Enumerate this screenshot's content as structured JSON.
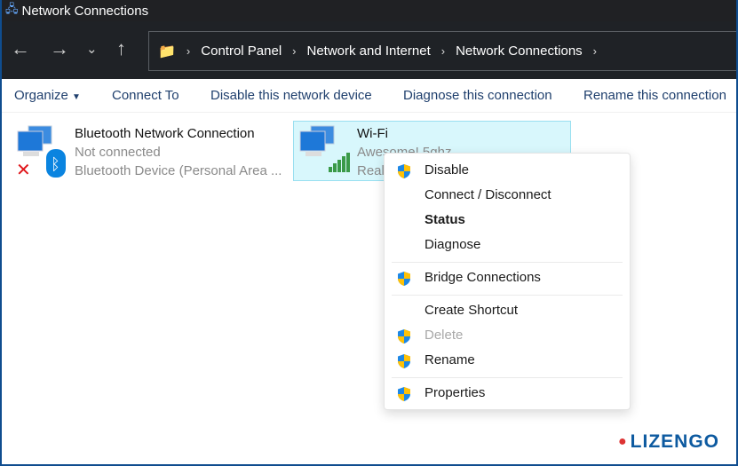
{
  "window": {
    "title": "Network Connections"
  },
  "breadcrumb": [
    "Control Panel",
    "Network and Internet",
    "Network Connections"
  ],
  "toolbar": {
    "organize": "Organize",
    "connect_to": "Connect To",
    "disable": "Disable this network device",
    "diagnose": "Diagnose this connection",
    "rename": "Rename this connection"
  },
  "connections": [
    {
      "name": "Bluetooth Network Connection",
      "status": "Not connected",
      "device": "Bluetooth Device (Personal Area ..."
    },
    {
      "name": "Wi-Fi",
      "status": "Awesome! 5ghz",
      "device": "Real"
    }
  ],
  "context_menu": [
    {
      "label": "Disable",
      "shield": true
    },
    {
      "label": "Connect / Disconnect",
      "shield": false
    },
    {
      "label": "Status",
      "shield": false,
      "bold": true
    },
    {
      "label": "Diagnose",
      "shield": false
    },
    {
      "label": "Bridge Connections",
      "shield": true
    },
    {
      "label": "Create Shortcut",
      "shield": false
    },
    {
      "label": "Delete",
      "shield": true,
      "disabled": true
    },
    {
      "label": "Rename",
      "shield": true
    },
    {
      "label": "Properties",
      "shield": true
    }
  ],
  "watermark": "LIZENGO"
}
